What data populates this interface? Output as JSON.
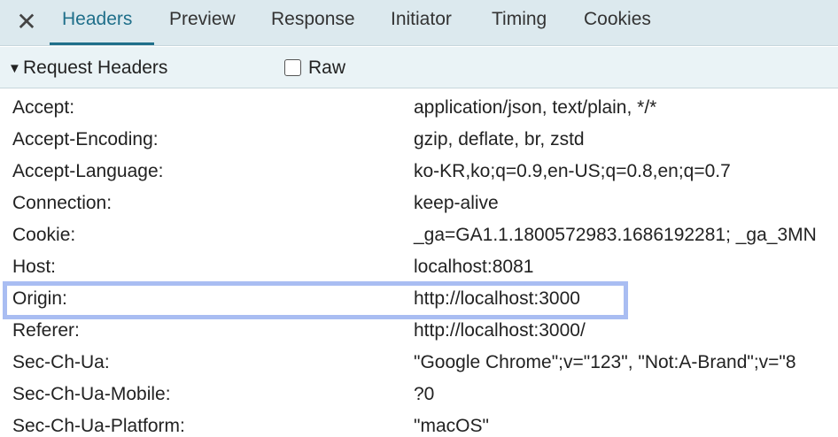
{
  "tabs": {
    "close_symbol": "✕",
    "items": [
      "Headers",
      "Preview",
      "Response",
      "Initiator",
      "Timing",
      "Cookies"
    ],
    "active": "Headers"
  },
  "section": {
    "title": "Request Headers",
    "raw_label": "Raw",
    "raw_checked": false
  },
  "headers": [
    {
      "key": "Accept:",
      "value": "application/json, text/plain, */*"
    },
    {
      "key": "Accept-Encoding:",
      "value": "gzip, deflate, br, zstd"
    },
    {
      "key": "Accept-Language:",
      "value": "ko-KR,ko;q=0.9,en-US;q=0.8,en;q=0.7"
    },
    {
      "key": "Connection:",
      "value": "keep-alive"
    },
    {
      "key": "Cookie:",
      "value": "_ga=GA1.1.1800572983.1686192281; _ga_3MN"
    },
    {
      "key": "Host:",
      "value": "localhost:8081"
    },
    {
      "key": "Origin:",
      "value": "http://localhost:3000"
    },
    {
      "key": "Referer:",
      "value": "http://localhost:3000/"
    },
    {
      "key": "Sec-Ch-Ua:",
      "value": "\"Google Chrome\";v=\"123\", \"Not:A-Brand\";v=\"8"
    },
    {
      "key": "Sec-Ch-Ua-Mobile:",
      "value": "?0"
    },
    {
      "key": "Sec-Ch-Ua-Platform:",
      "value": "\"macOS\""
    }
  ],
  "colors": {
    "tab_active": "#1f6f8a",
    "tabbar_bg": "#dce9ee",
    "highlight_border": "#a9bdf2"
  }
}
